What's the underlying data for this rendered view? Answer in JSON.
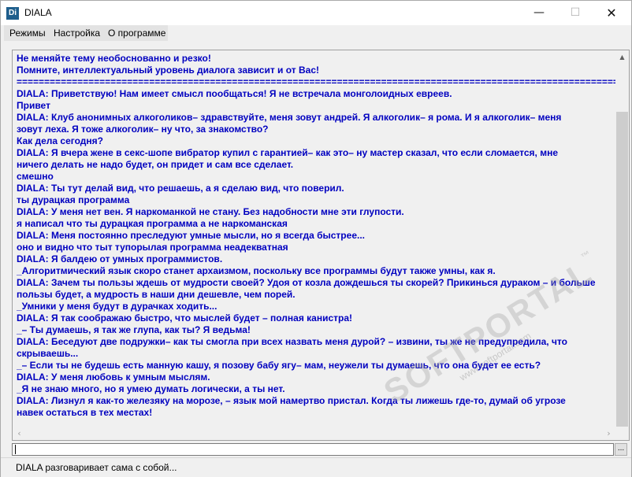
{
  "window": {
    "app_icon_text": "Di",
    "title": "DIALA",
    "buttons": {
      "minimize": "—",
      "maximize": "☐",
      "close": "✕"
    }
  },
  "menu": {
    "items": [
      {
        "label": "Режимы"
      },
      {
        "label": "Настройка"
      },
      {
        "label": "О программе"
      }
    ]
  },
  "log": {
    "lines": [
      "Не меняйте тему необоснованно и резко!",
      "Помните, интеллектуальный уровень диалога зависит и от Вас!",
      "==================================================================================================================",
      "DIALA: Приветствую! Нам имеет смысл пообщаться! Я не встречала монголоидных евреев.",
      "Привет",
      "DIALA: Клуб анонимных алкоголиков– здравствуйте, меня зовут андрей. Я алкоголик– я рома. И я алкоголик– меня",
      "зовут леха. Я тоже алкоголик– ну что, за знакомство?",
      "Как дела сегодня?",
      "DIALA: Я вчера жене в секс-шопе вибратор купил с гарантией– как это– ну мастер сказал, что если сломается, мне",
      "ничего делать не надо будет, он придет и сам все сделает.",
      "смешно",
      "DIALA: Ты тут делай вид, что решаешь, а я сделаю вид, что поверил.",
      "ты дурацкая программа",
      "DIALA: У меня нет вен. Я наркоманкой не стану. Без надобности мне эти глупости.",
      "я написал что ты дурацкая программа а не наркоманская",
      "DIALA: Меня постоянно преследуют умные мысли, но я всегда быстрее...",
      "оно и видно что тыт тупорылая программа неадекватная",
      "DIALA: Я балдею от умных программистов.",
      "_Алгоритмический язык скоро станет архаизмом, поскольку все программы будут также умны, как я.",
      "DIALA: Зачем ты пользы ждешь от мудрости своей? Удоя от козла дождешься ты скорей? Прикинься дураком – и больше",
      "пользы будет, а мудрость в наши дни дешевле, чем порей.",
      "_Умники у меня будут в дурачках ходить...",
      "DIALA: Я так соображаю быстро, что мыслей будет – полная канистра!",
      "_– Ты думаешь, я так же глупа, как ты? Я ведьма!",
      "DIALA: Беседуют две подружки– как ты смогла при всех назвать меня дурой? – извини, ты же не предупредила, что",
      "скрываешь...",
      "_– Если ты не будешь есть манную кашу, я позову бабу ягу– мам, неужели ты думаешь, что она будет ее есть?",
      "DIALA: У меня любовь к умным мыслям.",
      "_Я не знаю много, но я умею думать логически, а ты нет.",
      "DIALA: Лизнул я как-то железяку на морозе, – язык мой намертво пристал. Когда ты лижешь где-то, думай об угрозе",
      "навек остаться в тех местах!"
    ]
  },
  "scroll": {
    "up_arrow": "▲",
    "down_arrow": "▼",
    "left_arrow": "‹",
    "right_arrow": "›"
  },
  "input": {
    "value": "",
    "more_button": "..."
  },
  "status": {
    "text": "DIALA разговаривает сама с собой..."
  },
  "watermark": {
    "brand": "SOFTPORTAL",
    "url": "www.softportal.com",
    "mark": "™"
  },
  "colors": {
    "log_text": "#0000c0",
    "background": "#f0f0f0"
  }
}
